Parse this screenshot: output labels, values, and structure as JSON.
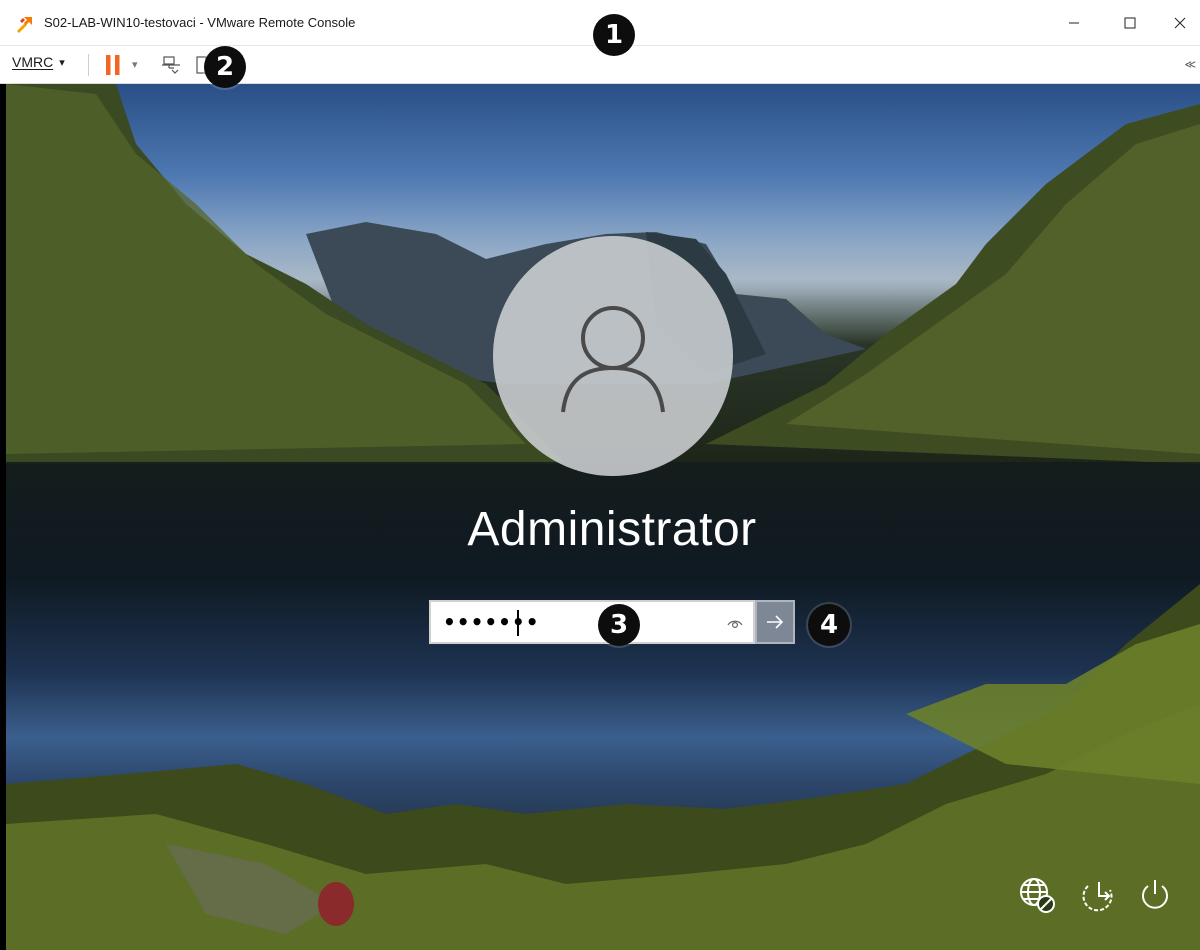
{
  "window": {
    "title": "S02-LAB-WIN10-testovaci - VMware Remote Console",
    "icons": [
      "vmrc-app-icon",
      "minimize-icon",
      "maximize-icon",
      "close-icon"
    ]
  },
  "toolbar": {
    "menu_label": "VMRC",
    "menu_caret": "▾",
    "pause_dropdown_caret": "▾",
    "collapse_label": "≪",
    "icons": [
      "pause-icon",
      "send-keys-icon"
    ],
    "pause_color": "#f26522"
  },
  "callouts": [
    "1",
    "2",
    "3",
    "4"
  ],
  "login": {
    "username": "Administrator",
    "password_mask": "•••••••",
    "icons": [
      "user-avatar-icon",
      "reveal-password-icon",
      "submit-arrow-icon"
    ]
  },
  "system_tray": {
    "icons": [
      "network-icon",
      "ease-of-access-icon",
      "power-icon"
    ]
  }
}
